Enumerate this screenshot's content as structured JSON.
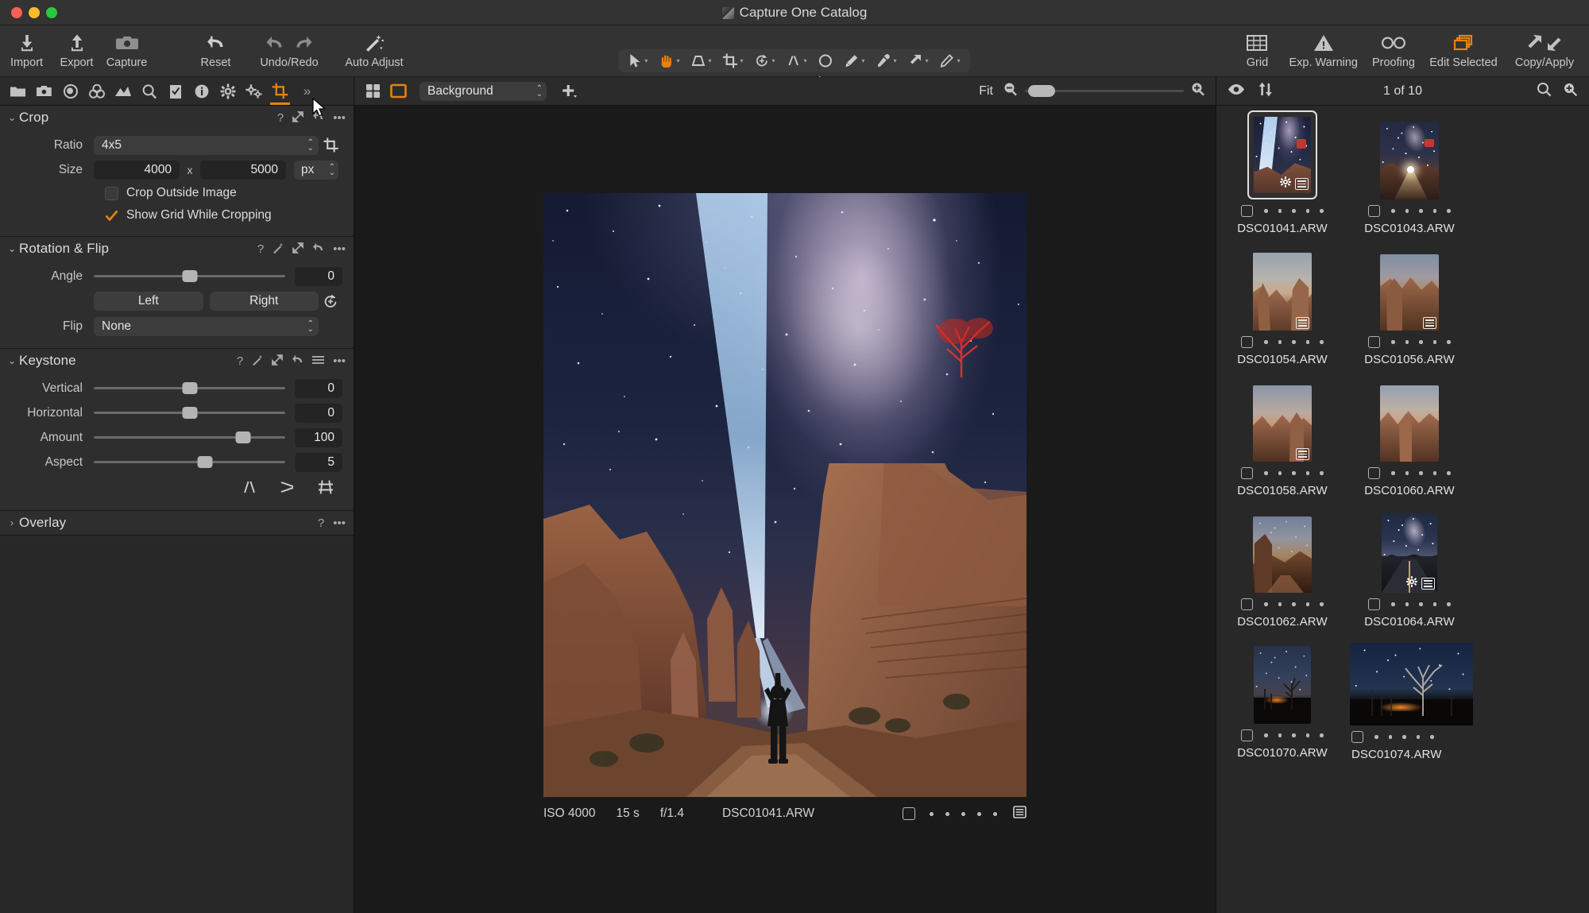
{
  "window": {
    "title": "Capture One Catalog",
    "app_icon": "capture-one-icon"
  },
  "toolbar": {
    "left_buttons": [
      {
        "label": "Import",
        "icon": "import-arrow-down-icon"
      },
      {
        "label": "Export",
        "icon": "export-arrow-up-icon"
      },
      {
        "label": "Capture",
        "icon": "camera-icon"
      }
    ],
    "mid_buttons": [
      {
        "label": "Reset",
        "icon": "reset-undo-arrow-icon"
      },
      {
        "label": "Undo/Redo",
        "icon": "undo-redo-arrows-icon"
      },
      {
        "label": "Auto Adjust",
        "icon": "magic-wand-icon"
      }
    ],
    "cursor_tools": {
      "label": "Cursor Tools",
      "items": [
        {
          "icon": "pointer-select-icon",
          "active": false,
          "has_caret": true
        },
        {
          "icon": "pan-hand-icon",
          "active": true,
          "has_caret": true
        },
        {
          "icon": "perspective-keystone-icon",
          "active": false,
          "has_caret": true
        },
        {
          "icon": "crop-icon",
          "active": false,
          "has_caret": true
        },
        {
          "icon": "rotate-icon",
          "active": false,
          "has_caret": true
        },
        {
          "icon": "straighten-icon",
          "active": false,
          "has_caret": true
        },
        {
          "icon": "spot-removal-circle-icon",
          "active": false,
          "has_caret": false
        },
        {
          "icon": "heal-brush-icon",
          "active": false,
          "has_caret": true
        },
        {
          "icon": "color-picker-eyedropper-icon",
          "active": false,
          "has_caret": true
        },
        {
          "icon": "draw-mask-arrow-icon",
          "active": false,
          "has_caret": true
        },
        {
          "icon": "pen-annotation-icon",
          "active": false,
          "has_caret": true
        }
      ]
    },
    "right_buttons": [
      {
        "label": "Grid",
        "icon": "grid-icon",
        "active": false
      },
      {
        "label": "Exp. Warning",
        "icon": "exposure-warning-triangle-icon",
        "active": false
      },
      {
        "label": "Proofing",
        "icon": "proofing-glasses-icon",
        "active": false
      },
      {
        "label": "Edit Selected",
        "icon": "edit-selected-layers-icon",
        "active": true
      },
      {
        "label": "Copy/Apply",
        "icon": "copy-apply-arrows-icon",
        "active": false
      }
    ]
  },
  "tool_tabs": [
    {
      "icon": "library-folder-icon",
      "active": false
    },
    {
      "icon": "capture-camera-icon",
      "active": false
    },
    {
      "icon": "lens-correction-icon",
      "active": false
    },
    {
      "icon": "color-wheels-icon",
      "active": false
    },
    {
      "icon": "exposure-histogram-icon",
      "active": false
    },
    {
      "icon": "details-magnifier-icon",
      "active": false
    },
    {
      "icon": "adjustments-clipboard-icon",
      "active": false
    },
    {
      "icon": "metadata-info-icon",
      "active": false
    },
    {
      "icon": "output-gear-icon",
      "active": false
    },
    {
      "icon": "batch-gears-icon",
      "active": false
    },
    {
      "icon": "crop-tool-tab-icon",
      "active": true
    },
    {
      "icon": "more-chevrons-icon",
      "active": false
    }
  ],
  "panels": {
    "crop": {
      "title": "Crop",
      "collapsed": false,
      "actions": [
        "help-icon",
        "expand-icon",
        "reset-arrow-icon",
        "ellipsis-icon"
      ],
      "ratio": {
        "label": "Ratio",
        "value": "4x5"
      },
      "crop_button_icon": "crop-frame-icon",
      "size": {
        "label": "Size",
        "width": "4000",
        "separator": "x",
        "height": "5000",
        "unit": "px"
      },
      "crop_outside": {
        "label": "Crop Outside Image",
        "checked": false
      },
      "show_grid": {
        "label": "Show Grid While Cropping",
        "checked": true
      }
    },
    "rotation_flip": {
      "title": "Rotation & Flip",
      "collapsed": false,
      "actions": [
        "help-icon",
        "wand-icon",
        "expand-icon",
        "reset-arrow-icon",
        "ellipsis-icon"
      ],
      "angle": {
        "label": "Angle",
        "value": "0",
        "percent": 50
      },
      "left_button": "Left",
      "right_button": "Right",
      "rotate_reset_icon": "rotate-reset-icon",
      "flip": {
        "label": "Flip",
        "value": "None"
      }
    },
    "keystone": {
      "title": "Keystone",
      "collapsed": false,
      "actions": [
        "help-icon",
        "wand-icon",
        "expand-icon",
        "reset-arrow-icon",
        "menu-lines-icon",
        "ellipsis-icon"
      ],
      "sliders": [
        {
          "label": "Vertical",
          "value": "0",
          "percent": 50
        },
        {
          "label": "Horizontal",
          "value": "0",
          "percent": 50
        },
        {
          "label": "Amount",
          "value": "100",
          "percent": 78
        },
        {
          "label": "Aspect",
          "value": "5",
          "percent": 58
        }
      ],
      "footer_icons": [
        "keystone-vertical-icon",
        "keystone-horizontal-icon",
        "keystone-both-icon"
      ]
    },
    "overlay": {
      "title": "Overlay",
      "collapsed": true,
      "actions": [
        "help-icon",
        "ellipsis-icon"
      ]
    }
  },
  "viewer": {
    "bar": {
      "multi_view_icon": "multi-view-grid-icon",
      "single_view_icon": "single-view-icon",
      "background": "Background",
      "add_icon": "add-plus-icon",
      "fit_label": "Fit",
      "zoom_out_icon": "zoom-out-icon",
      "zoom_in_icon": "zoom-in-icon",
      "zoom_percent": 9
    },
    "image_info": {
      "iso": "ISO 4000",
      "shutter": "15 s",
      "aperture": "f/1.4",
      "filename": "DSC01041.ARW",
      "rating_dots": 5,
      "pick_checkbox": false,
      "sheet_icon": "adjustments-sheet-icon"
    }
  },
  "browser": {
    "bar": {
      "visibility_icon": "eye-icon",
      "sort_icon": "sort-arrows-icon",
      "count_label": "1 of 10",
      "search_icon": "search-icon",
      "zoom_icon": "thumbnail-zoom-icon"
    },
    "thumbnails": [
      {
        "filename": "DSC01041.ARW",
        "selected": true,
        "orientation": "portrait",
        "art": "beam",
        "badges": [
          "gear",
          "sheet"
        ],
        "dots": 5
      },
      {
        "filename": "DSC01043.ARW",
        "selected": false,
        "orientation": "portrait",
        "art": "lantern",
        "badges": [],
        "dots": 5
      },
      {
        "filename": "DSC01054.ARW",
        "selected": false,
        "orientation": "portrait",
        "art": "hoodoo",
        "badges": [
          "sheet"
        ],
        "dots": 5
      },
      {
        "filename": "DSC01056.ARW",
        "selected": false,
        "orientation": "portrait",
        "art": "hoodoo2",
        "badges": [
          "sheet"
        ],
        "dots": 5
      },
      {
        "filename": "DSC01058.ARW",
        "selected": false,
        "orientation": "portrait",
        "art": "canyon",
        "badges": [
          "sheet"
        ],
        "dots": 5
      },
      {
        "filename": "DSC01060.ARW",
        "selected": false,
        "orientation": "portrait",
        "art": "hoodoo3",
        "badges": [],
        "dots": 5
      },
      {
        "filename": "DSC01062.ARW",
        "selected": false,
        "orientation": "portrait",
        "art": "trail",
        "badges": [],
        "dots": 5
      },
      {
        "filename": "DSC01064.ARW",
        "selected": false,
        "orientation": "portrait",
        "art": "road",
        "badges": [
          "gear",
          "sheet"
        ],
        "dots": 5
      },
      {
        "filename": "DSC01070.ARW",
        "selected": false,
        "orientation": "portrait",
        "art": "tree",
        "badges": [],
        "dots": 5
      },
      {
        "filename": "DSC01074.ARW",
        "selected": false,
        "orientation": "landscape",
        "art": "treewide",
        "badges": [],
        "dots": 5
      }
    ]
  },
  "colors": {
    "accent": "#e8820c",
    "panel_bg": "#2e2e2e",
    "window_bg": "#282828",
    "toolbar_bg": "#333333",
    "viewer_bg": "#1a1a1a",
    "text": "#dcdcdc"
  }
}
